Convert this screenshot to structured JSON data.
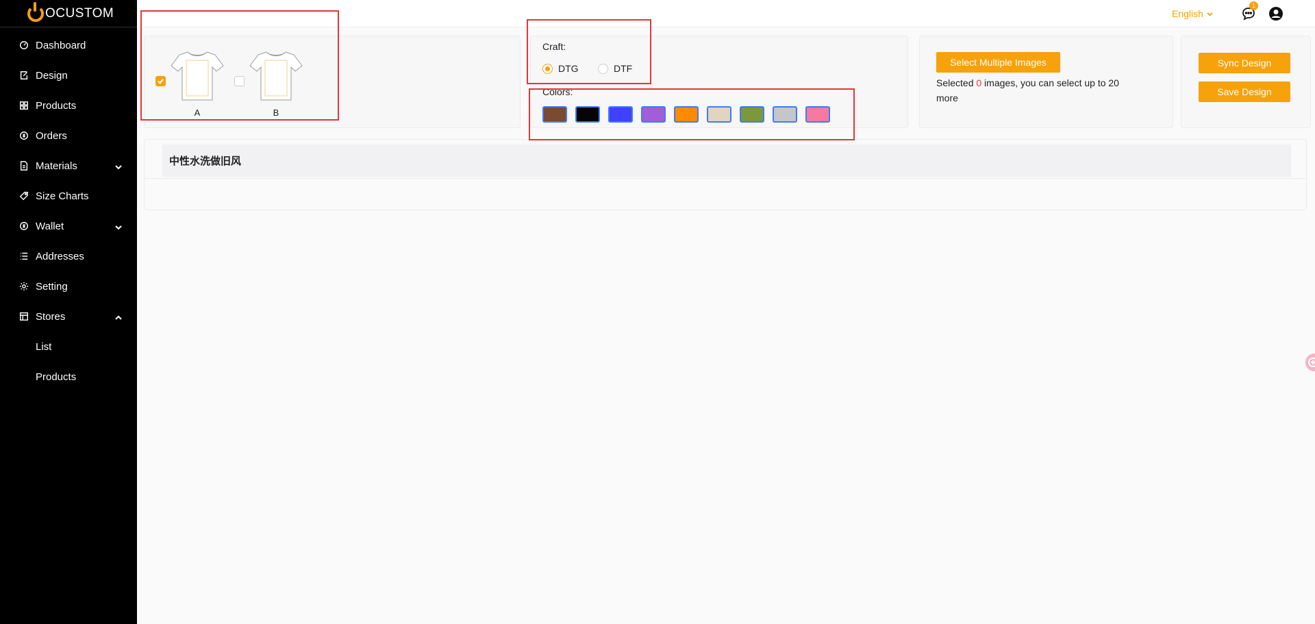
{
  "brand": {
    "name": "OCUSTOM",
    "accent": "#f7a10b"
  },
  "sidebar": {
    "items": [
      {
        "label": "Dashboard",
        "icon": "dashboard-icon"
      },
      {
        "label": "Design",
        "icon": "design-icon"
      },
      {
        "label": "Products",
        "icon": "products-icon"
      },
      {
        "label": "Orders",
        "icon": "orders-icon"
      },
      {
        "label": "Materials",
        "icon": "materials-icon",
        "expand": "down"
      },
      {
        "label": "Size Charts",
        "icon": "tag-icon"
      },
      {
        "label": "Wallet",
        "icon": "wallet-icon",
        "expand": "down"
      },
      {
        "label": "Addresses",
        "icon": "list-icon"
      },
      {
        "label": "Setting",
        "icon": "gear-icon"
      },
      {
        "label": "Stores",
        "icon": "store-icon",
        "expand": "up"
      }
    ],
    "sub_items": [
      {
        "label": "List"
      },
      {
        "label": "Products"
      }
    ]
  },
  "header": {
    "language": "English",
    "notification_count": "1"
  },
  "products": [
    {
      "label": "A",
      "checked": true
    },
    {
      "label": "B",
      "checked": false
    }
  ],
  "craft": {
    "label": "Craft:",
    "options": [
      {
        "label": "DTG",
        "selected": true
      },
      {
        "label": "DTF",
        "selected": false
      }
    ]
  },
  "colors": {
    "label": "Colors:",
    "swatches": [
      "#7a4a32",
      "#050505",
      "#4040ff",
      "#a05fd8",
      "#ff8a00",
      "#e0d5c3",
      "#7a9a3a",
      "#c3c6ca",
      "#f57aa2"
    ]
  },
  "images": {
    "button": "Select Multiple Images",
    "text_prefix": "Selected ",
    "count": "0",
    "text_suffix": " images, you can select up to 20 more"
  },
  "actions": {
    "sync": "Sync Design",
    "save": "Save Design"
  },
  "section": {
    "title": "中性水洗做旧风"
  }
}
